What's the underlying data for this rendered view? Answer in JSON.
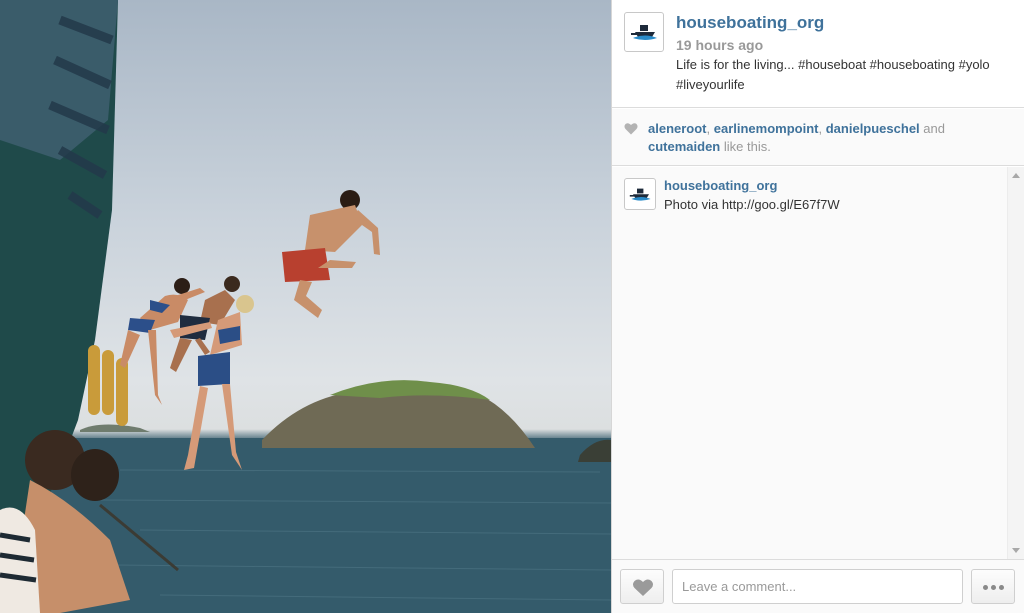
{
  "post": {
    "username": "houseboating_org",
    "time_ago": "19 hours ago",
    "caption": "Life is for the living... #houseboat #houseboating #yolo #liveyourlife",
    "avatar_icon": "houseboat-logo-icon"
  },
  "likes": {
    "likers": [
      "aleneroot",
      "earlinemompoint",
      "danielpueschel",
      "cutemaiden"
    ],
    "sep": ", ",
    "and_text": "and",
    "suffix": "like this."
  },
  "comments": [
    {
      "username": "houseboating_org",
      "text": "Photo via http://goo.gl/E67f7W"
    }
  ],
  "footer": {
    "comment_placeholder": "Leave a comment...",
    "like_icon": "heart-icon",
    "more_icon": "more-dots-icon"
  },
  "colors": {
    "link": "#3f729b",
    "muted": "#999999",
    "text": "#333333",
    "sea": "#2f5566",
    "sky": "#c9d2db"
  }
}
